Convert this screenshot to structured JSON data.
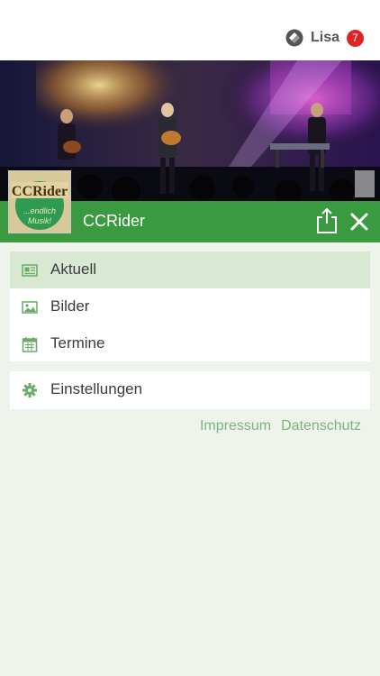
{
  "topbar": {
    "user_name": "Lisa",
    "notification_count": "7"
  },
  "group": {
    "name": "CCRider",
    "logo_text": "CCRider",
    "logo_tagline_1": "...endlich",
    "logo_tagline_2": "Musik!"
  },
  "menu": {
    "items": [
      {
        "label": "Aktuell",
        "icon": "newspaper-icon",
        "active": true
      },
      {
        "label": "Bilder",
        "icon": "image-icon",
        "active": false
      },
      {
        "label": "Termine",
        "icon": "calendar-icon",
        "active": false
      }
    ],
    "settings": {
      "label": "Einstellungen",
      "icon": "gear-icon"
    }
  },
  "footer": {
    "impressum": "Impressum",
    "datenschutz": "Datenschutz"
  },
  "colors": {
    "accent_green": "#3a9a3f",
    "active_bg": "#d8e8d2",
    "icon_green": "#6aab69",
    "badge_red": "#e02424",
    "link_green": "#7cb57d",
    "page_bg": "#eef4ec"
  }
}
